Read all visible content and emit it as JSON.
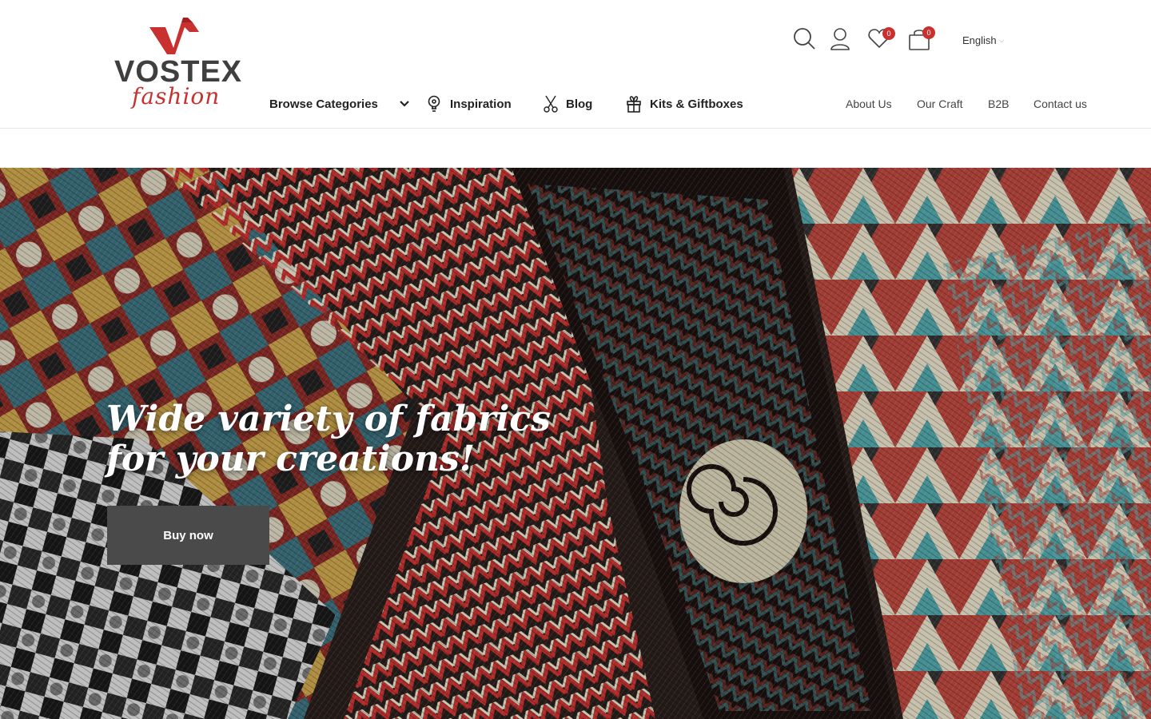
{
  "brand": {
    "name": "VOSTEX",
    "tagline": "fashion",
    "primary_color": "#c8312f",
    "text_color": "#3f3f3f"
  },
  "header": {
    "icons": [
      {
        "name": "search-icon"
      },
      {
        "name": "user-icon"
      },
      {
        "name": "heart-icon",
        "badge": "0"
      },
      {
        "name": "cart-icon",
        "badge": "0"
      }
    ],
    "language": "English"
  },
  "nav": {
    "browse_categories": "Browse Categories",
    "inspiration": "Inspiration",
    "blog": "Blog",
    "kits": "Kits & Giftboxes",
    "about": "About Us",
    "craft": "Our Craft",
    "b2b": "B2B",
    "contact": "Contact us"
  },
  "hero": {
    "title_line1": "Wide variety of fabrics",
    "title_line2": "for your creations!",
    "cta": "Buy now"
  }
}
